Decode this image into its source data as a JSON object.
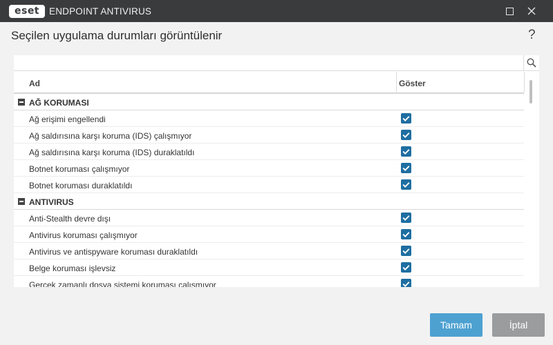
{
  "window": {
    "logo_text": "eset",
    "app_name": "ENDPOINT ANTIVIRUS",
    "maximize_icon": "maximize-icon",
    "close_icon": "close-icon"
  },
  "page": {
    "title": "Seçilen uygulama durumları görüntülenir",
    "help": "?"
  },
  "search": {
    "value": "",
    "placeholder": "",
    "icon": "search-icon"
  },
  "table": {
    "columns": [
      "Ad",
      "Göster"
    ],
    "groups": [
      {
        "name": "AĞ KORUMASI",
        "items": [
          {
            "label": "Ağ erişimi engellendi",
            "checked": true
          },
          {
            "label": "Ağ saldırısına karşı koruma (IDS) çalışmıyor",
            "checked": true
          },
          {
            "label": "Ağ saldırısına karşı koruma (IDS) duraklatıldı",
            "checked": true
          },
          {
            "label": "Botnet koruması çalışmıyor",
            "checked": true
          },
          {
            "label": "Botnet koruması duraklatıldı",
            "checked": true
          }
        ]
      },
      {
        "name": "ANTIVIRUS",
        "items": [
          {
            "label": "Anti-Stealth devre dışı",
            "checked": true
          },
          {
            "label": "Antivirus koruması çalışmıyor",
            "checked": true
          },
          {
            "label": "Antivirus ve antispyware koruması duraklatıldı",
            "checked": true
          },
          {
            "label": "Belge koruması işlevsiz",
            "checked": true
          },
          {
            "label": "Gerçek zamanlı dosya sistemi koruması çalışmıyor",
            "checked": true
          }
        ]
      }
    ]
  },
  "buttons": {
    "ok": "Tamam",
    "cancel": "İptal"
  },
  "colors": {
    "titlebar": "#3a3b3d",
    "checkbox": "#1e6ea1",
    "ok_button": "#4da1d1",
    "cancel_button": "#9a9c9e"
  }
}
